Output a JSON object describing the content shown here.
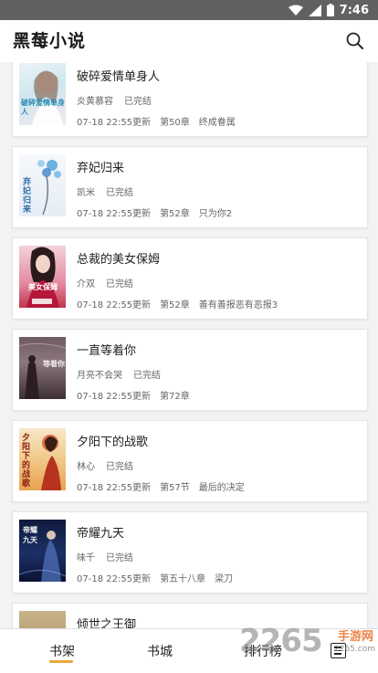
{
  "status_bar": {
    "time": "7:46",
    "icons": [
      "wifi-icon",
      "signal-icon",
      "battery-icon"
    ]
  },
  "header": {
    "title": "黑莓小说",
    "search_icon": "search-icon"
  },
  "books": [
    {
      "title": "破碎爱情单身人",
      "author": "炎黄慕容",
      "status": "已完结",
      "updated": "07-18 22:55更新",
      "chapter": "第50章",
      "chapter_title": "终成眷属",
      "cover_text": "破碎爱情单身人"
    },
    {
      "title": "弃妃归来",
      "author": "凯米",
      "status": "已完结",
      "updated": "07-18 22:55更新",
      "chapter": "第52章",
      "chapter_title": "只为你2",
      "cover_text": "弃妃归来"
    },
    {
      "title": "总裁的美女保姆",
      "author": "介双",
      "status": "已完结",
      "updated": "07-18 22:55更新",
      "chapter": "第52章",
      "chapter_title": "善有善报恶有恶报3",
      "cover_text": "美女保姆"
    },
    {
      "title": "一直等着你",
      "author": "月亮不会哭",
      "status": "已完结",
      "updated": "07-18 22:55更新",
      "chapter": "第72章",
      "chapter_title": "",
      "cover_text": "等着你"
    },
    {
      "title": "夕阳下的战歌",
      "author": "林心",
      "status": "已完结",
      "updated": "07-18 22:55更新",
      "chapter": "第57节",
      "chapter_title": "最后的决定",
      "cover_text": "夕阳下的战歌"
    },
    {
      "title": "帝耀九天",
      "author": "味千",
      "status": "已完结",
      "updated": "07-18 22:55更新",
      "chapter": "第五十八章",
      "chapter_title": "梁刀",
      "cover_text": "帝耀九天"
    },
    {
      "title": "倾世之王御",
      "author": "",
      "status": "",
      "updated": "",
      "chapter": "",
      "chapter_title": "",
      "cover_text": ""
    }
  ],
  "bottom_nav": {
    "items": [
      "书架",
      "书城",
      "排行榜"
    ],
    "active_index": 0,
    "menu_icon": "menu-icon"
  },
  "watermark": {
    "number": "2265",
    "site": "手游网",
    "url": "2265.com"
  }
}
